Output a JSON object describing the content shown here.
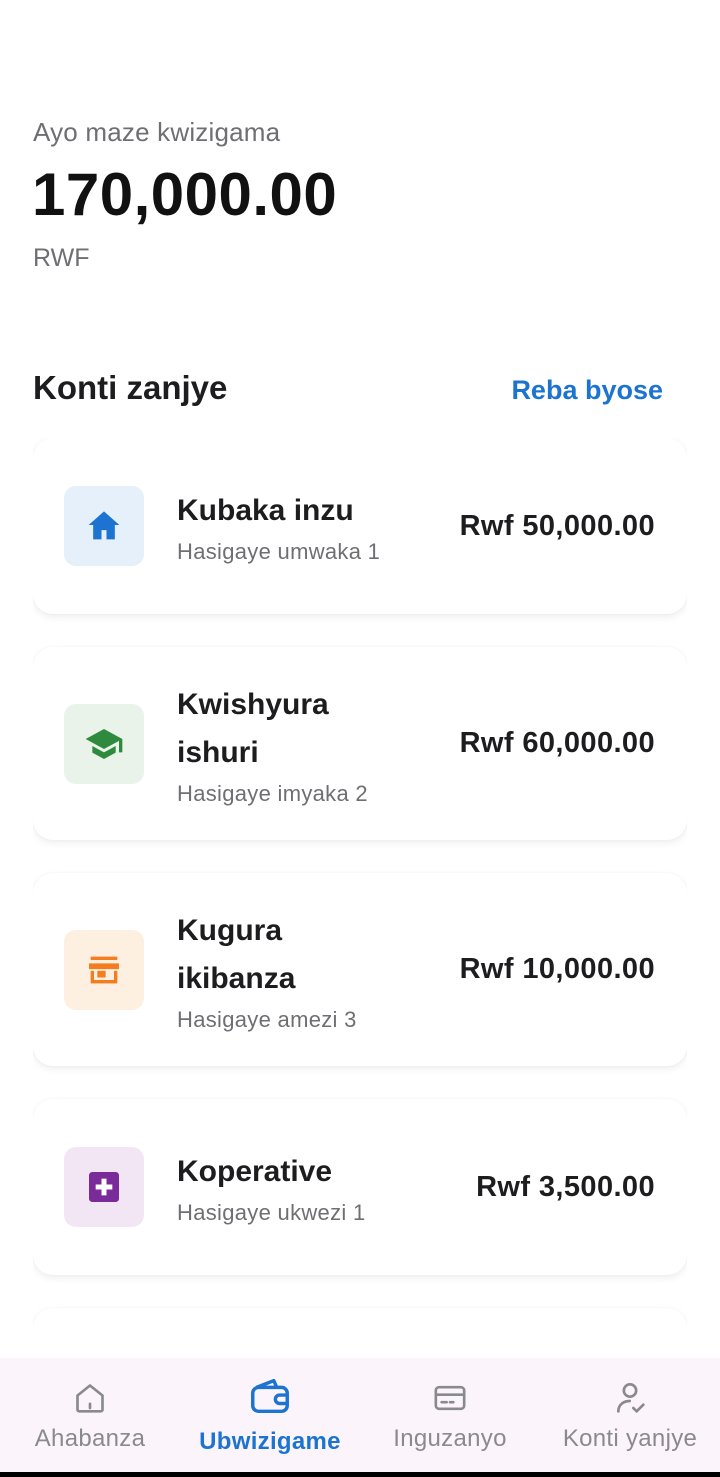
{
  "summary": {
    "label": "Ayo maze kwizigama",
    "amount": "170,000.00",
    "currency": "RWF"
  },
  "accounts_section": {
    "title": "Konti zanjye",
    "see_all": "Reba byose"
  },
  "accounts": [
    {
      "title": "Kubaka inzu",
      "remaining": "Hasigaye umwaka 1",
      "amount": "Rwf 50,000.00",
      "icon": "house-icon",
      "icon_color": "#1c74d0",
      "icon_bg": "#e6f0fb"
    },
    {
      "title": "Kwishyura ishuri",
      "remaining": "Hasigaye imyaka 2",
      "amount": "Rwf 60,000.00",
      "icon": "graduation-cap-icon",
      "icon_color": "#2e8b3e",
      "icon_bg": "#e9f3ea"
    },
    {
      "title": "Kugura ikibanza",
      "remaining": "Hasigaye amezi 3",
      "amount": "Rwf 10,000.00",
      "icon": "store-icon",
      "icon_color": "#f57c1f",
      "icon_bg": "#fdf0e1"
    },
    {
      "title": "Koperative",
      "remaining": "Hasigaye ukwezi 1",
      "amount": "Rwf 3,500.00",
      "icon": "medical-cross-icon",
      "icon_color": "#7b2a9a",
      "icon_bg": "#f2e6f4"
    }
  ],
  "bottom_nav": {
    "items": [
      {
        "label": "Ahabanza",
        "icon": "home-icon",
        "active": false
      },
      {
        "label": "Ubwizigame",
        "icon": "wallet-icon",
        "active": true
      },
      {
        "label": "Inguzanyo",
        "icon": "card-icon",
        "active": false
      },
      {
        "label": "Konti yanjye",
        "icon": "user-check-icon",
        "active": false
      }
    ]
  },
  "colors": {
    "accent": "#1c74d0",
    "nav_bg": "#fcf4fb",
    "muted_text": "#6f6f73"
  }
}
